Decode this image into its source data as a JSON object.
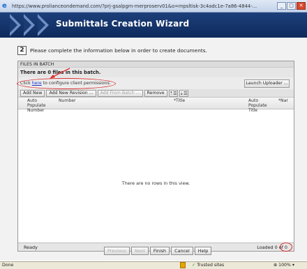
{
  "browser": {
    "url": "https://www.prolianceondemand.com/?prj-gsalpgm-merproserv01&o=mpsltisk-3c4adc1e-7a86-4844-..."
  },
  "wizard": {
    "title": "Submittals Creation Wizard",
    "step_number": "2",
    "step_text": "Please complete the information below in order to create documents."
  },
  "panel": {
    "header": "FILES IN BATCH",
    "files_count": "There are 0 files in this batch.",
    "perm_prefix": "Click ",
    "perm_link": "here",
    "perm_suffix": " to configure client permissions.",
    "launch_uploader": "Launch Uploader ..."
  },
  "toolbar": {
    "add_new": "Add New",
    "add_new_revision": "Add New Revision ...",
    "add_from_batch": "Add From Batch ...",
    "remove": "Remove"
  },
  "grid": {
    "columns": [
      "Auto Populate Number",
      "Number",
      "*Title",
      "Auto Populate Title",
      "*Nar"
    ],
    "empty_message": "There are no rows in this view.",
    "status_ready": "Ready",
    "status_loaded": "Loaded 0 of 0"
  },
  "buttons": {
    "previous": "Previous",
    "next": "Next",
    "finish": "Finish",
    "cancel": "Cancel",
    "help": "Help"
  },
  "statusbar": {
    "done": "Done",
    "trusted": "Trusted sites",
    "zoom": "100%"
  },
  "colors": {
    "header_bg": "#0e2a5c",
    "annotation_red": "#d93030",
    "link": "#1a33c8"
  }
}
